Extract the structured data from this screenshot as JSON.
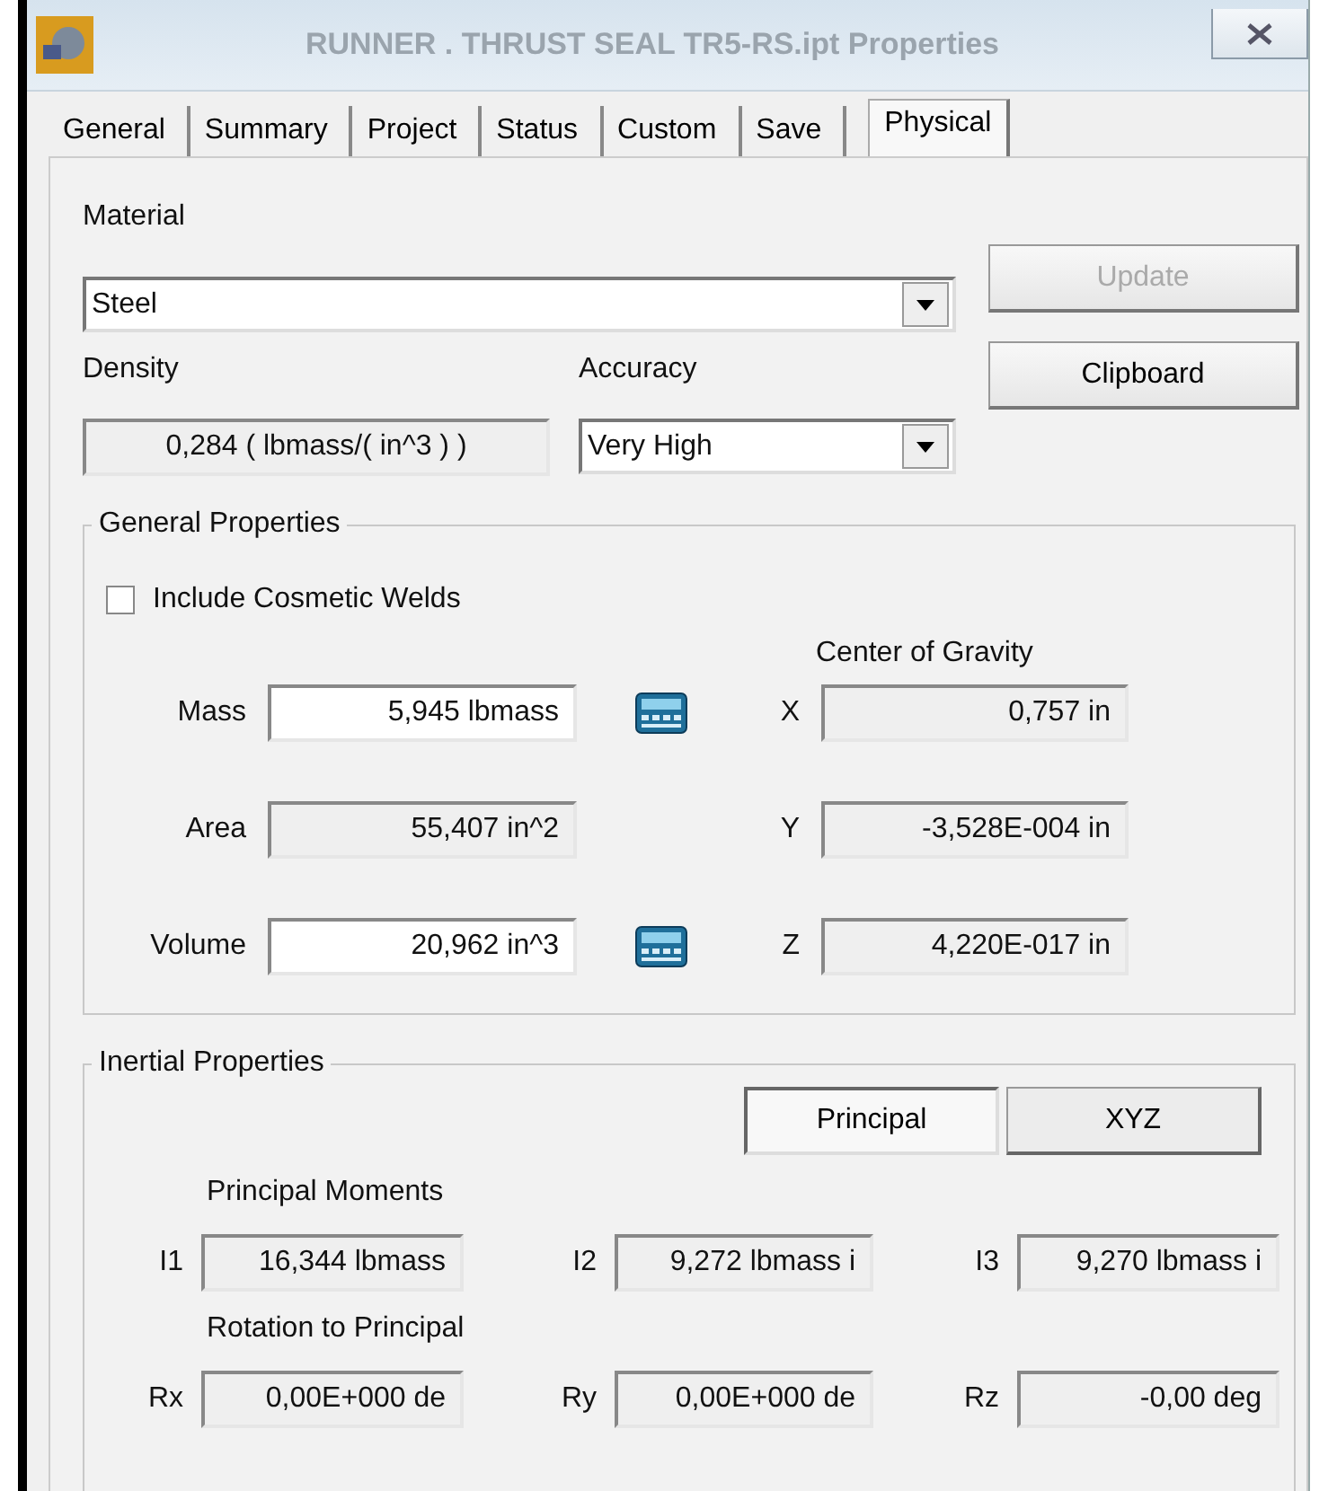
{
  "window": {
    "title": "RUNNER . THRUST SEAL TR5-RS.ipt Properties"
  },
  "tabs": [
    {
      "label": "General",
      "selected": false
    },
    {
      "label": "Summary",
      "selected": false
    },
    {
      "label": "Project",
      "selected": false
    },
    {
      "label": "Status",
      "selected": false
    },
    {
      "label": "Custom",
      "selected": false
    },
    {
      "label": "Save",
      "selected": false
    },
    {
      "label": "Physical",
      "selected": true
    }
  ],
  "material": {
    "label": "Material",
    "value": "Steel"
  },
  "buttons": [
    {
      "label": "Update",
      "disabled": true
    },
    {
      "label": "Clipboard",
      "disabled": false
    }
  ],
  "density": {
    "label": "Density",
    "value": "0,284 ( lbmass/( in^3 ) )"
  },
  "accuracy": {
    "label": "Accuracy",
    "value": "Very High"
  },
  "general_properties": {
    "title": "General Properties",
    "include_cosmetic_welds": {
      "label": "Include Cosmetic Welds",
      "checked": false
    },
    "center_of_gravity_label": "Center of Gravity",
    "rows": [
      {
        "label": "Mass",
        "value": "5,945 lbmass",
        "readonly": false,
        "calculator": true,
        "axis": "X",
        "cog": "0,757 in"
      },
      {
        "label": "Area",
        "value": "55,407 in^2",
        "readonly": true,
        "calculator": false,
        "axis": "Y",
        "cog": "-3,528E-004 in"
      },
      {
        "label": "Volume",
        "value": "20,962 in^3",
        "readonly": false,
        "calculator": true,
        "axis": "Z",
        "cog": "4,220E-017 in"
      }
    ]
  },
  "inertial_properties": {
    "title": "Inertial Properties",
    "modes": [
      {
        "label": "Principal",
        "selected": true
      },
      {
        "label": "XYZ",
        "selected": false
      }
    ],
    "moments_label": "Principal Moments",
    "moments": [
      {
        "label": "I1",
        "value": "16,344 lbmass"
      },
      {
        "label": "I2",
        "value": "9,272 lbmass i"
      },
      {
        "label": "I3",
        "value": "9,270 lbmass i"
      }
    ],
    "rotation_label": "Rotation to Principal",
    "rotations": [
      {
        "label": "Rx",
        "value": "0,00E+000 de"
      },
      {
        "label": "Ry",
        "value": "0,00E+000 de"
      },
      {
        "label": "Rz",
        "value": "-0,00 deg"
      }
    ]
  }
}
